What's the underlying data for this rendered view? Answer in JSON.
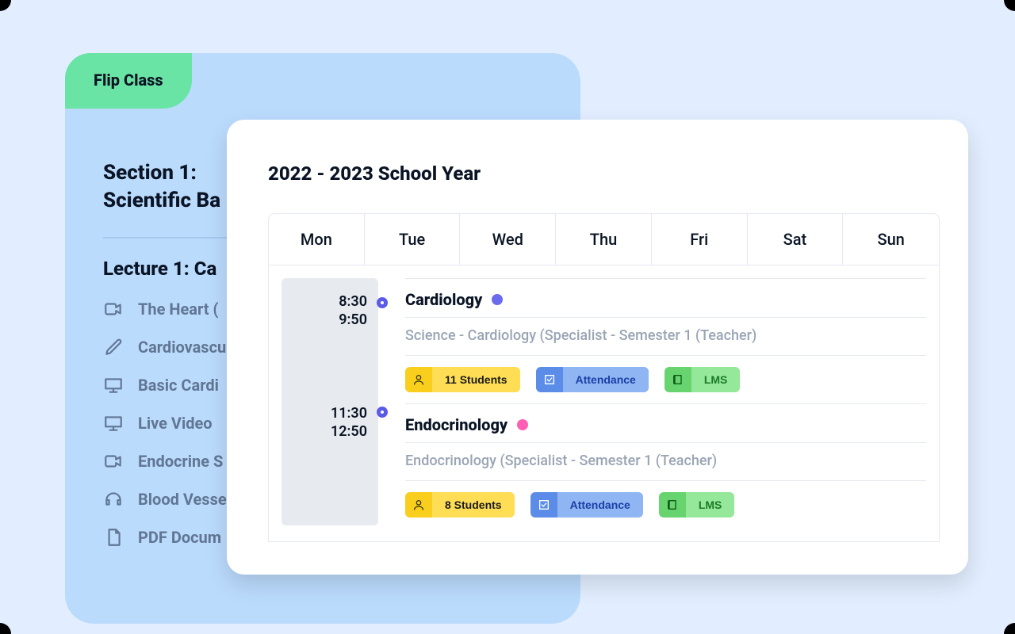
{
  "flip": {
    "tab": "Flip Class",
    "section_line1": "Section 1:",
    "section_line2": "Scientific Ba",
    "lecture": "Lecture 1: Ca",
    "items": [
      {
        "icon": "video",
        "label": "The Heart ("
      },
      {
        "icon": "pencil",
        "label": "Cardiovascu"
      },
      {
        "icon": "monitor",
        "label": "Basic Cardi"
      },
      {
        "icon": "monitor",
        "label": "Live Video"
      },
      {
        "icon": "video",
        "label": "Endocrine S"
      },
      {
        "icon": "headphones",
        "label": "Blood Vesse"
      },
      {
        "icon": "document",
        "label": "PDF Docum"
      }
    ]
  },
  "schedule": {
    "title": "2022 - 2023 School Year",
    "days": [
      "Mon",
      "Tue",
      "Wed",
      "Thu",
      "Fri",
      "Sat",
      "Sun"
    ],
    "slots": [
      {
        "start": "8:30",
        "end": "9:50",
        "title": "Cardiology",
        "dot": "violet",
        "sub": "Science - Cardiology (Specialist - Semester 1 (Teacher)",
        "students": "11 Students",
        "attendance": "Attendance",
        "lms": "LMS"
      },
      {
        "start": "11:30",
        "end": "12:50",
        "title": "Endocrinology",
        "dot": "pink",
        "sub": "Endocrinology (Specialist - Semester 1 (Teacher)",
        "students": "8 Students",
        "attendance": "Attendance",
        "lms": "LMS"
      }
    ]
  }
}
